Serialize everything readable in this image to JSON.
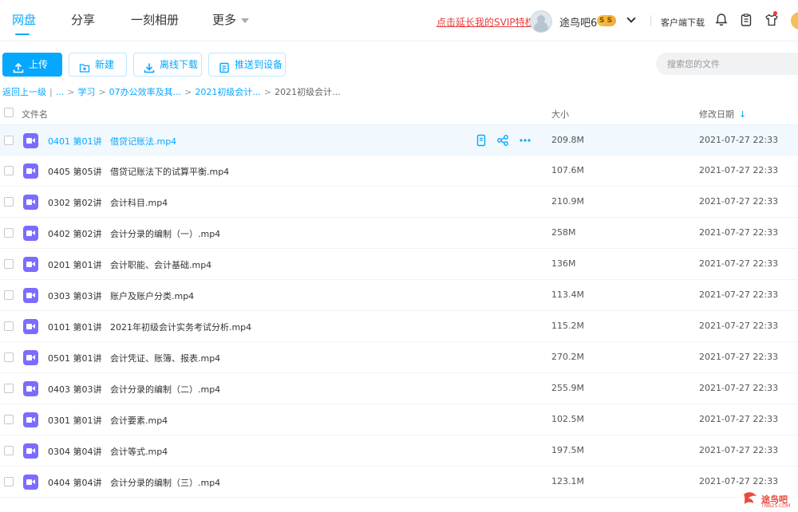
{
  "nav": {
    "tabs": [
      "网盘",
      "分享",
      "一刻相册",
      "更多"
    ],
    "svip_link": "点击延长我的SVIP特权",
    "username": "途鸟吧6",
    "badge": "S S",
    "client_download": "客户端下载"
  },
  "toolbar": {
    "upload": "上传",
    "new": "新建",
    "offline": "离线下载",
    "push": "推送到设备",
    "search_placeholder": "搜索您的文件"
  },
  "breadcrumb": {
    "back": "返回上一级",
    "more": "...",
    "items": [
      "学习",
      "07办公效率及其...",
      "2021初级会计..."
    ],
    "current": "2021初级会计..."
  },
  "table": {
    "headers": {
      "name": "文件名",
      "size": "大小",
      "date": "修改日期"
    },
    "rows": [
      {
        "name": "0401 第01讲   借贷记账法.mp4",
        "size": "209.8M",
        "date": "2021-07-27 22:33"
      },
      {
        "name": "0405 第05讲   借贷记账法下的试算平衡.mp4",
        "size": "107.6M",
        "date": "2021-07-27 22:33"
      },
      {
        "name": "0302 第02讲   会计科目.mp4",
        "size": "210.9M",
        "date": "2021-07-27 22:33"
      },
      {
        "name": "0402 第02讲   会计分录的编制（一）.mp4",
        "size": "258M",
        "date": "2021-07-27 22:33"
      },
      {
        "name": "0201 第01讲   会计职能、会计基础.mp4",
        "size": "136M",
        "date": "2021-07-27 22:33"
      },
      {
        "name": "0303 第03讲   账户及账户分类.mp4",
        "size": "113.4M",
        "date": "2021-07-27 22:33"
      },
      {
        "name": "0101 第01讲   2021年初级会计实务考试分析.mp4",
        "size": "115.2M",
        "date": "2021-07-27 22:33"
      },
      {
        "name": "0501 第01讲   会计凭证、账簿、报表.mp4",
        "size": "270.2M",
        "date": "2021-07-27 22:33"
      },
      {
        "name": "0403 第03讲   会计分录的编制（二）.mp4",
        "size": "255.9M",
        "date": "2021-07-27 22:33"
      },
      {
        "name": "0301 第01讲   会计要素.mp4",
        "size": "102.5M",
        "date": "2021-07-27 22:33"
      },
      {
        "name": "0304 第04讲   会计等式.mp4",
        "size": "197.5M",
        "date": "2021-07-27 22:33"
      },
      {
        "name": "0404 第04讲   会计分录的编制（三）.mp4",
        "size": "123.1M",
        "date": "2021-07-27 22:33"
      }
    ]
  },
  "watermark": {
    "text": "途鸟吧",
    "sub": "TNBZS.COM"
  },
  "colors": {
    "accent": "#06a7ff",
    "svip": "#e83a3a",
    "video_icon": "#7b6cff"
  }
}
